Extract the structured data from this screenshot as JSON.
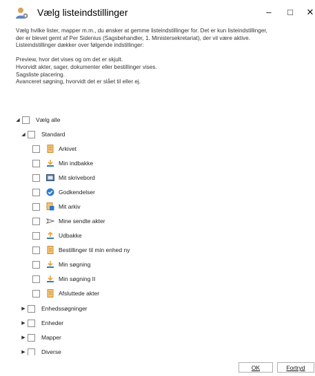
{
  "window": {
    "title": "Vælg listeindstillinger",
    "minimize_glyph": "–",
    "maximize_glyph": "□",
    "close_glyph": "✕"
  },
  "description": {
    "lines": [
      "Vælg hvilke lister, mapper m.m., du ønsker at gemme listeindstillinger for. Det er kun listeindstillinger,",
      "der er blevet gemt af Per Sidenius (Sagsbehandler, 1. Ministersekretariat), der vil være aktive.",
      "Listeindstillinger dækker over følgende indstillinger:"
    ],
    "settings": [
      "Preview, hvor det vises og om det er skjult.",
      "Hvorvidt akter, sager, dokumenter eller bestillinger vises.",
      "Sagsliste placering.",
      "Avanceret søgning, hvorvidt det er slået til eller ej."
    ]
  },
  "tree": {
    "select_all": "Vælg alle",
    "standard": "Standard",
    "standard_items": [
      {
        "label": "Arkivet",
        "icon": "archive-icon"
      },
      {
        "label": "Min indbakke",
        "icon": "inbox-icon"
      },
      {
        "label": "Mit skrivebord",
        "icon": "desk-icon"
      },
      {
        "label": "Godkendelser",
        "icon": "approval-icon"
      },
      {
        "label": "Mit arkiv",
        "icon": "my-archive-icon"
      },
      {
        "label": "Mine sendte akter",
        "icon": "sent-icon"
      },
      {
        "label": "Udbakke",
        "icon": "outbox-icon"
      },
      {
        "label": "Bestillinger til min enhed ny",
        "icon": "orders-icon"
      },
      {
        "label": "Min søgning",
        "icon": "search-download-icon"
      },
      {
        "label": "Min søgning II",
        "icon": "search-download-icon"
      },
      {
        "label": "Afsluttede akter",
        "icon": "archive-icon"
      }
    ],
    "collapsed_groups": [
      "Enhedssøgninger",
      "Enheder",
      "Mapper",
      "Diverse"
    ]
  },
  "buttons": {
    "ok_label": "OK",
    "cancel_label": "Fortryd"
  },
  "colors": {
    "checkbox_border": "#8a8a8a",
    "folder_yellow": "#e8a33d",
    "download_blue": "#2b79c7",
    "approval_blue": "#2e7cd0"
  }
}
